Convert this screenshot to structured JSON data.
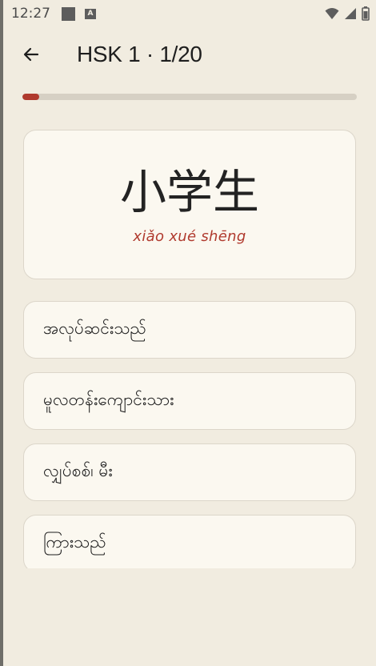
{
  "status_bar": {
    "time": "12:27"
  },
  "app_bar": {
    "title": "HSK 1 · 1/20"
  },
  "progress": {
    "current": 1,
    "total": 20,
    "fraction": 0.05,
    "color": "#b03a2e"
  },
  "word": {
    "hanzi": "小学生",
    "pinyin": "xiǎo xué shēng"
  },
  "options": [
    {
      "label": "အလုပ်ဆင်းသည်"
    },
    {
      "label": "မူလတန်းကျောင်းသား"
    },
    {
      "label": "လျှပ်စစ်၊ မီး"
    },
    {
      "label": "ကြားသည်"
    }
  ],
  "colors": {
    "background": "#f1ece0",
    "card": "#fbf8f0",
    "accent": "#b03a2e"
  },
  "icons": {
    "back": "arrow-left-icon",
    "wifi": "wifi-icon",
    "signal": "cell-signal-icon",
    "battery": "battery-icon"
  }
}
